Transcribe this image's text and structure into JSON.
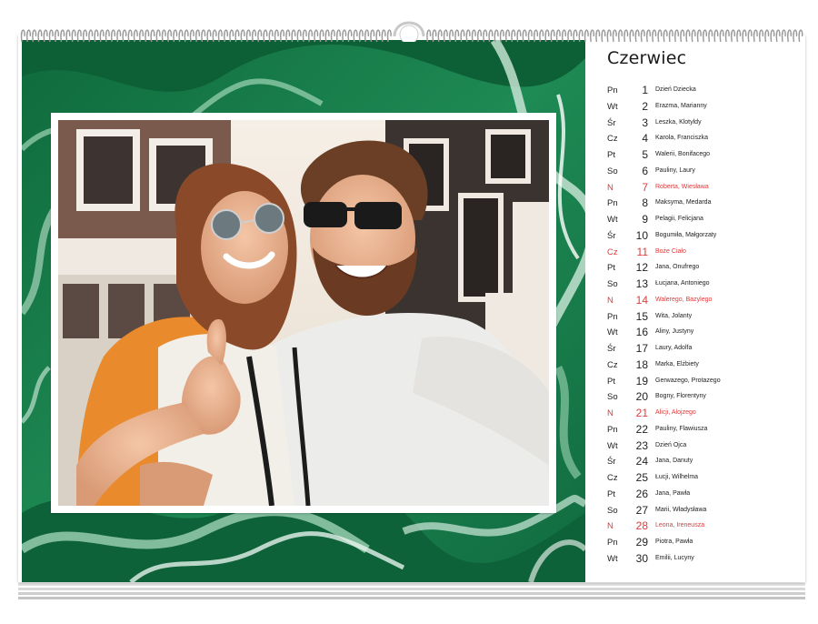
{
  "calendar": {
    "month": "Czerwiec",
    "days": [
      {
        "dow": "Pn",
        "num": "1",
        "names": "Dzień Dziecka",
        "holiday": false
      },
      {
        "dow": "Wt",
        "num": "2",
        "names": "Erazma, Marianny",
        "holiday": false
      },
      {
        "dow": "Śr",
        "num": "3",
        "names": "Leszka, Klotyldy",
        "holiday": false
      },
      {
        "dow": "Cz",
        "num": "4",
        "names": "Karola, Franciszka",
        "holiday": false
      },
      {
        "dow": "Pt",
        "num": "5",
        "names": "Walerii, Bonifacego",
        "holiday": false
      },
      {
        "dow": "So",
        "num": "6",
        "names": "Pauliny, Laury",
        "holiday": false
      },
      {
        "dow": "N",
        "num": "7",
        "names": "Roberta, Wiesława",
        "holiday": true
      },
      {
        "dow": "Pn",
        "num": "8",
        "names": "Maksyma, Medarda",
        "holiday": false
      },
      {
        "dow": "Wt",
        "num": "9",
        "names": "Pelagii, Felicjana",
        "holiday": false
      },
      {
        "dow": "Śr",
        "num": "10",
        "names": "Bogumiła, Małgorzaty",
        "holiday": false
      },
      {
        "dow": "Cz",
        "num": "11",
        "names": "Boże Ciało",
        "holiday": true
      },
      {
        "dow": "Pt",
        "num": "12",
        "names": "Jana, Onufrego",
        "holiday": false
      },
      {
        "dow": "So",
        "num": "13",
        "names": "Łucjana, Antoniego",
        "holiday": false
      },
      {
        "dow": "N",
        "num": "14",
        "names": "Walerego, Bazylego",
        "holiday": true
      },
      {
        "dow": "Pn",
        "num": "15",
        "names": "Wita, Jolanty",
        "holiday": false
      },
      {
        "dow": "Wt",
        "num": "16",
        "names": "Aliny, Justyny",
        "holiday": false
      },
      {
        "dow": "Śr",
        "num": "17",
        "names": "Laury, Adolfa",
        "holiday": false
      },
      {
        "dow": "Cz",
        "num": "18",
        "names": "Marka, Elżbiety",
        "holiday": false
      },
      {
        "dow": "Pt",
        "num": "19",
        "names": "Gerwazego, Protazego",
        "holiday": false
      },
      {
        "dow": "So",
        "num": "20",
        "names": "Bogny, Florentyny",
        "holiday": false
      },
      {
        "dow": "N",
        "num": "21",
        "names": "Alicji, Alojzego",
        "holiday": true
      },
      {
        "dow": "Pn",
        "num": "22",
        "names": "Pauliny, Flawiusza",
        "holiday": false
      },
      {
        "dow": "Wt",
        "num": "23",
        "names": "Dzień Ojca",
        "holiday": false
      },
      {
        "dow": "Śr",
        "num": "24",
        "names": "Jana, Danuty",
        "holiday": false
      },
      {
        "dow": "Cz",
        "num": "25",
        "names": "Łucji, Wilhelma",
        "holiday": false
      },
      {
        "dow": "Pt",
        "num": "26",
        "names": "Jana, Pawła",
        "holiday": false
      },
      {
        "dow": "So",
        "num": "27",
        "names": "Marii, Władysława",
        "holiday": false
      },
      {
        "dow": "N",
        "num": "28",
        "names": "Leona, Ireneusza",
        "holiday": true
      },
      {
        "dow": "Pn",
        "num": "29",
        "names": "Piotra, Pawła",
        "holiday": false
      },
      {
        "dow": "Wt",
        "num": "30",
        "names": "Emilii, Lucyny",
        "holiday": false
      }
    ]
  },
  "colors": {
    "holiday": "#e03a3a",
    "marble_green": "#1b7a4a"
  },
  "photo": {
    "subject": "couple-selfie-photo"
  }
}
